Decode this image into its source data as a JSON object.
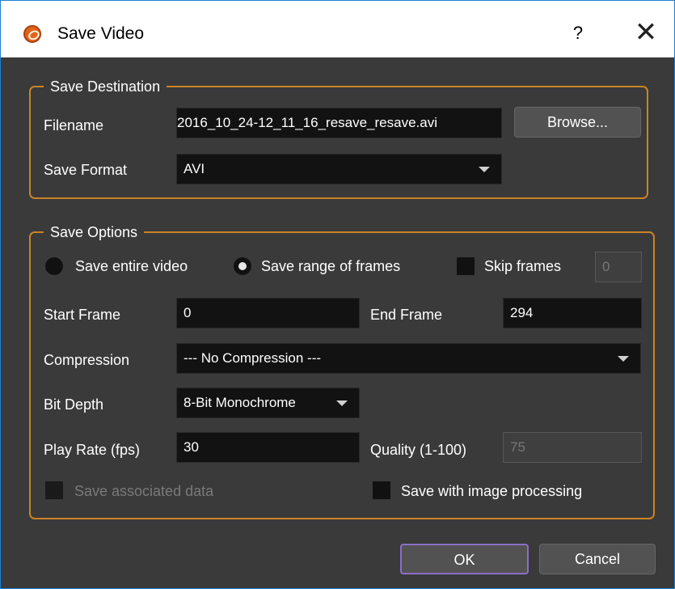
{
  "window": {
    "title": "Save Video",
    "help_label": "?",
    "close_label": "✕"
  },
  "destination": {
    "legend": "Save Destination",
    "filename_label": "Filename",
    "filename_value": "2016_10_24-12_11_16_resave_resave.avi",
    "browse_label": "Browse...",
    "format_label": "Save Format",
    "format_value": "AVI"
  },
  "options": {
    "legend": "Save Options",
    "radio_entire_label": "Save entire video",
    "radio_entire_checked": false,
    "radio_range_label": "Save range of frames",
    "radio_range_checked": true,
    "skip_label": "Skip frames",
    "skip_value": "0",
    "start_label": "Start Frame",
    "start_value": "0",
    "end_label": "End Frame",
    "end_value": "294",
    "compression_label": "Compression",
    "compression_value": "--- No Compression ---",
    "bitdepth_label": "Bit Depth",
    "bitdepth_value": "8-Bit Monochrome",
    "playrate_label": "Play Rate (fps)",
    "playrate_value": "30",
    "quality_label": "Quality (1-100)",
    "quality_value": "75",
    "assoc_label": "Save associated data",
    "imgproc_label": "Save with image processing"
  },
  "footer": {
    "ok_label": "OK",
    "cancel_label": "Cancel"
  },
  "colors": {
    "group_border": "#c98327",
    "background": "#3a3a3a",
    "ok_border": "#8a6fc7"
  }
}
